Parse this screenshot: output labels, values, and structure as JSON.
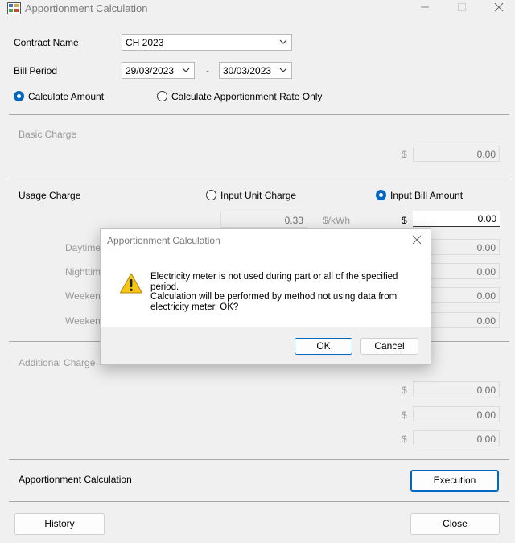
{
  "window": {
    "title": "Apportionment Calculation"
  },
  "form": {
    "contract_name_label": "Contract Name",
    "contract_name_value": "CH 2023",
    "bill_period_label": "Bill Period",
    "bill_period_from": "29/03/2023",
    "bill_period_sep": "-",
    "bill_period_to": "30/03/2023",
    "mode_options": [
      {
        "label": "Calculate Amount",
        "selected": true
      },
      {
        "label": "Calculate Apportionment Rate Only",
        "selected": false
      }
    ]
  },
  "basic_charge": {
    "label": "Basic Charge",
    "currency": "$",
    "amount": "0.00"
  },
  "usage_charge": {
    "label": "Usage Charge",
    "options": [
      {
        "label": "Input Unit Charge",
        "selected": false
      },
      {
        "label": "Input Bill Amount",
        "selected": true
      }
    ],
    "unit_rate": "0.33",
    "unit": "$/kWh",
    "currency": "$",
    "amount": "0.00",
    "rows": [
      {
        "label": "Daytime",
        "amount": "0.00"
      },
      {
        "label": "Nighttime",
        "amount": "0.00"
      },
      {
        "label": "Weekend",
        "amount": "0.00"
      },
      {
        "label": "Weekend",
        "amount": "0.00"
      }
    ]
  },
  "additional_charge": {
    "label": "Additional Charge",
    "currency": "$",
    "amounts": [
      "0.00",
      "0.00",
      "0.00"
    ]
  },
  "apportionment": {
    "label": "Apportionment Calculation",
    "execute_label": "Execution"
  },
  "footer": {
    "history_label": "History",
    "close_label": "Close"
  },
  "dialog": {
    "title": "Apportionment Calculation",
    "icon": "warning-icon",
    "line1": "Electricity meter is not used during part or all of the specified",
    "line2": "period.",
    "line3": "Calculation will be performed by method not using data from",
    "line4": "electricity meter. OK?",
    "ok_label": "OK",
    "cancel_label": "Cancel"
  },
  "colors": {
    "accent": "#0067c0",
    "warning": "#f5c518"
  }
}
